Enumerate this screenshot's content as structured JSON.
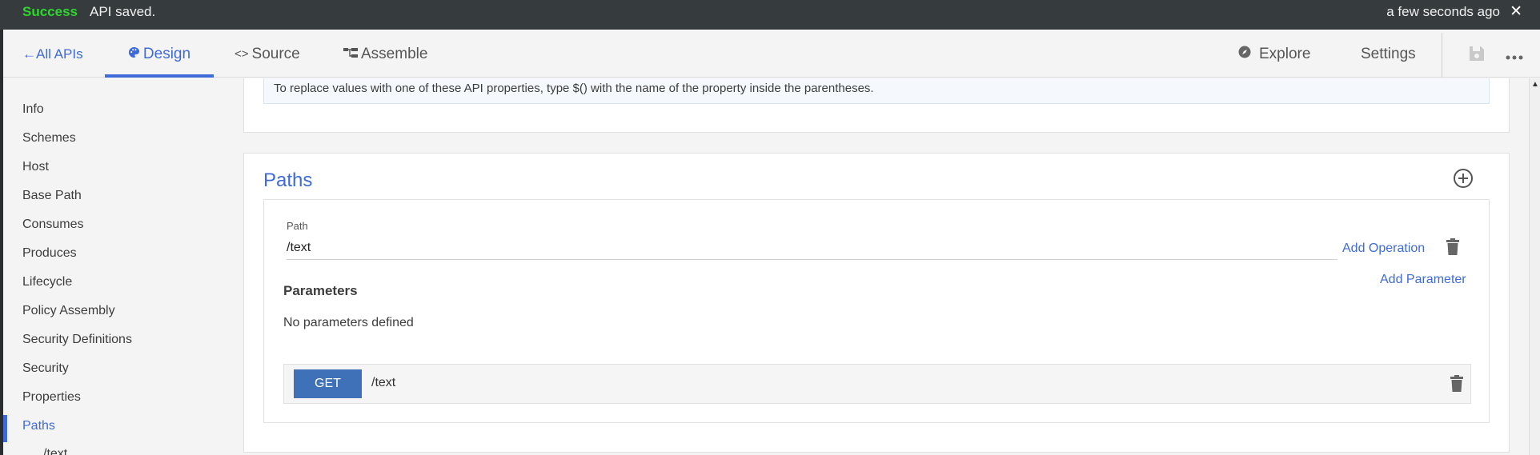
{
  "notification": {
    "status": "Success",
    "message": "API saved.",
    "time": "a few seconds ago",
    "close": "✕"
  },
  "nav": {
    "back": "All APIs",
    "back_arrow": "←",
    "design": "Design",
    "source": "Source",
    "source_glyph": "<>",
    "assemble": "Assemble",
    "explore": "Explore",
    "settings": "Settings"
  },
  "sidebar": {
    "items": [
      {
        "label": "Info"
      },
      {
        "label": "Schemes"
      },
      {
        "label": "Host"
      },
      {
        "label": "Base Path"
      },
      {
        "label": "Consumes"
      },
      {
        "label": "Produces"
      },
      {
        "label": "Lifecycle"
      },
      {
        "label": "Policy Assembly"
      },
      {
        "label": "Security Definitions"
      },
      {
        "label": "Security"
      },
      {
        "label": "Properties"
      },
      {
        "label": "Paths"
      },
      {
        "label": "/text"
      }
    ],
    "active_item": "Paths"
  },
  "properties_section": {
    "info_text": "To replace values with one of these API properties, type $() with the name of the property inside the parentheses."
  },
  "paths_section": {
    "title": "Paths",
    "path_label": "Path",
    "path_value": "/text",
    "add_operation": "Add Operation",
    "parameters_title": "Parameters",
    "add_parameter": "Add Parameter",
    "no_parameters": "No parameters defined",
    "operation": {
      "method": "GET",
      "path": "/text"
    }
  },
  "colors": {
    "accent": "#3f6ad8",
    "success": "#2fd62f",
    "notification_bg": "#363b3d",
    "get_button": "#3e71b8"
  },
  "icons": {
    "design": "palette-icon",
    "source": "code-icon",
    "assemble": "flow-icon",
    "explore": "compass-icon",
    "save": "save-icon",
    "more": "more-icon",
    "add": "add-circle-icon",
    "delete": "trash-icon"
  }
}
